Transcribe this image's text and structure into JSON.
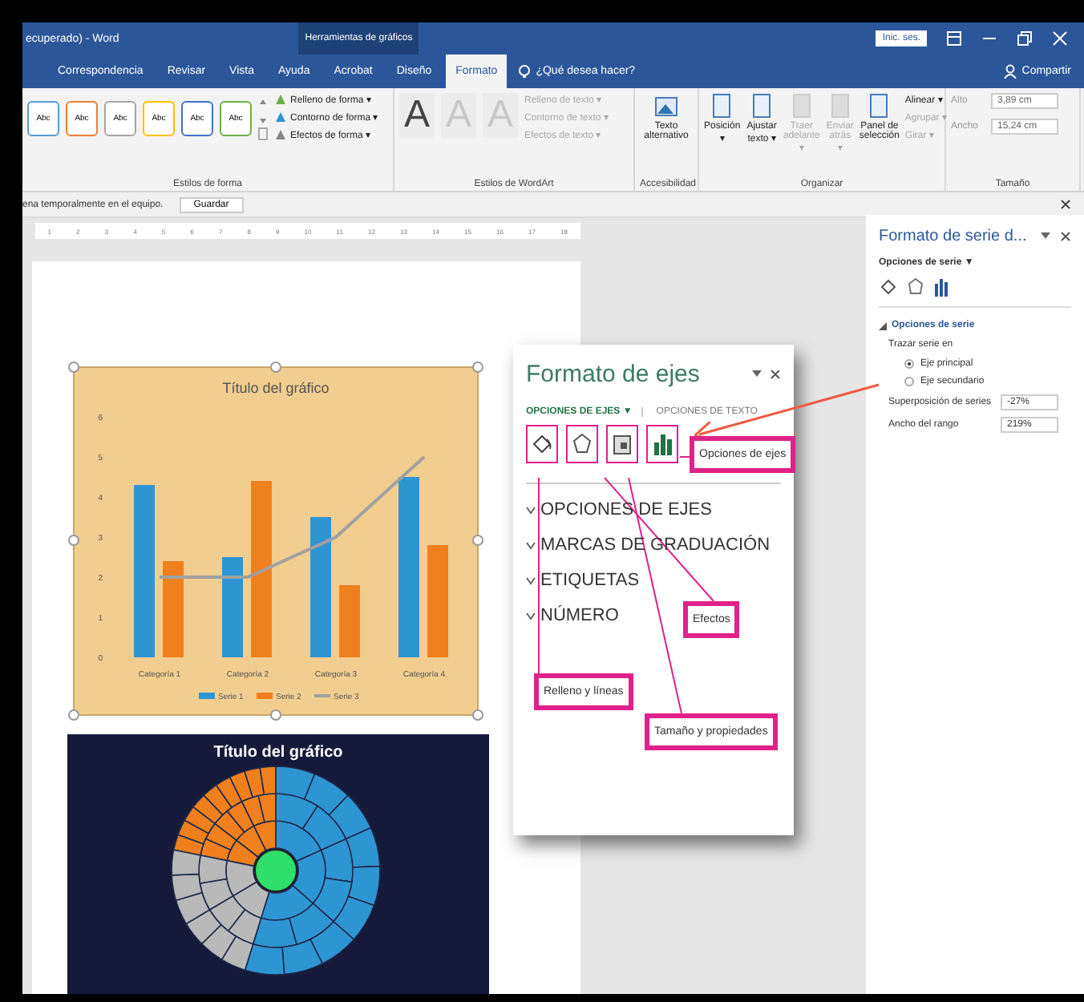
{
  "window": {
    "title": "ecuperado) - Word",
    "context_title": "Herramientas de gráficos",
    "sign_in": "Inic. ses.",
    "share": "Compartir"
  },
  "tabs": [
    {
      "label": "Correspondencia",
      "selected": false
    },
    {
      "label": "Revisar",
      "selected": false
    },
    {
      "label": "Vista",
      "selected": false
    },
    {
      "label": "Ayuda",
      "selected": false
    },
    {
      "label": "Acrobat",
      "selected": false
    },
    {
      "label": "Diseño",
      "selected": false
    },
    {
      "label": "Formato",
      "selected": true
    }
  ],
  "tell_me": "¿Qué desea hacer?",
  "ribbon": {
    "shape_styles": {
      "label": "Estilos de forma",
      "swatches": [
        {
          "text": "Abc",
          "color": "#5b9bd5"
        },
        {
          "text": "Abc",
          "color": "#ed7d31"
        },
        {
          "text": "Abc",
          "color": "#a5a5a5"
        },
        {
          "text": "Abc",
          "color": "#ffc000"
        },
        {
          "text": "Abc",
          "color": "#4472c4"
        },
        {
          "text": "Abc",
          "color": "#70ad47"
        }
      ],
      "commands": [
        {
          "label": "Relleno de forma ▾",
          "disabled": false
        },
        {
          "label": "Contorno de forma ▾",
          "disabled": false
        },
        {
          "label": "Efectos de forma ▾",
          "disabled": false
        }
      ]
    },
    "wordart": {
      "label": "Estilos de WordArt",
      "letters": [
        "A",
        "A",
        "A"
      ],
      "commands": [
        {
          "label": "Relleno de texto ▾",
          "disabled": true
        },
        {
          "label": "Contorno de texto ▾",
          "disabled": true
        },
        {
          "label": "Efectos de texto ▾",
          "disabled": true
        }
      ]
    },
    "accessibility": {
      "label": "Accesibilidad",
      "button": "Texto alternativo"
    },
    "arrange": {
      "label": "Organizar",
      "buttons": [
        {
          "label": "Posición ▾",
          "disabled": false
        },
        {
          "label": "Ajustar texto ▾",
          "disabled": false
        },
        {
          "label": "Traer adelante ▾",
          "disabled": true
        },
        {
          "label": "Enviar atrás ▾",
          "disabled": true
        },
        {
          "label": "Panel de selección",
          "disabled": false
        }
      ],
      "small": [
        {
          "label": "Alinear ▾",
          "disabled": false
        },
        {
          "label": "Agrupar ▾",
          "disabled": true
        },
        {
          "label": "Girar ▾",
          "disabled": true
        }
      ]
    },
    "size": {
      "label": "Tamaño",
      "fields": [
        {
          "label": "Alto",
          "value": "3,89 cm"
        },
        {
          "label": "Ancho",
          "value": "15,24 cm"
        }
      ]
    }
  },
  "message_bar": {
    "text": "ena temporalmente en el equipo.",
    "button": "Guardar"
  },
  "ruler": [
    "1",
    "2",
    "3",
    "4",
    "5",
    "6",
    "7",
    "8",
    "9",
    "10",
    "11",
    "12",
    "13",
    "14",
    "15",
    "16",
    "17",
    "18"
  ],
  "chart_data": {
    "type": "bar",
    "title": "Título del gráfico",
    "categories": [
      "Categoría 1",
      "Categoría 2",
      "Categoría 3",
      "Categoría 4"
    ],
    "ylim": [
      0,
      6
    ],
    "legend": "bottom",
    "yticks": [
      0,
      1,
      2,
      3,
      4,
      5,
      6
    ],
    "series": [
      {
        "name": "Serie 1",
        "color": "#2e95d3",
        "type": "bar",
        "values": [
          4.3,
          2.5,
          3.5,
          4.5
        ]
      },
      {
        "name": "Serie 2",
        "color": "#f0801e",
        "type": "bar",
        "values": [
          2.4,
          4.4,
          1.8,
          2.8
        ]
      },
      {
        "name": "Serie 3",
        "color": "#a0a0a0",
        "type": "line",
        "values": [
          2,
          2,
          3,
          5
        ]
      }
    ]
  },
  "sunburst": {
    "title": "Título del gráfico"
  },
  "axis_panel": {
    "title": "Formato de ejes",
    "tabs": [
      {
        "label": "OPCIONES DE EJES ▼",
        "selected": true
      },
      {
        "label": "OPCIONES DE TEXTO",
        "selected": false
      }
    ],
    "sections": [
      "OPCIONES DE EJES",
      "MARCAS DE GRADUACIÓN",
      "ETIQUETAS",
      "NÚMERO"
    ],
    "callouts": [
      "Opciones de ejes",
      "Efectos",
      "Relleno y líneas",
      "Tamaño y propiedades"
    ]
  },
  "series_pane": {
    "title": "Formato de serie d...",
    "dropdown": "Opciones de serie ▼",
    "section": "Opciones de serie",
    "plot_on_label": "Trazar serie en",
    "plot_on": [
      {
        "label": "Eje principal",
        "selected": true
      },
      {
        "label": "Eje secundario",
        "selected": false
      }
    ],
    "fields": [
      {
        "label": "Superposición de series",
        "value": "-27%"
      },
      {
        "label": "Ancho del rango",
        "value": "219%"
      }
    ]
  }
}
